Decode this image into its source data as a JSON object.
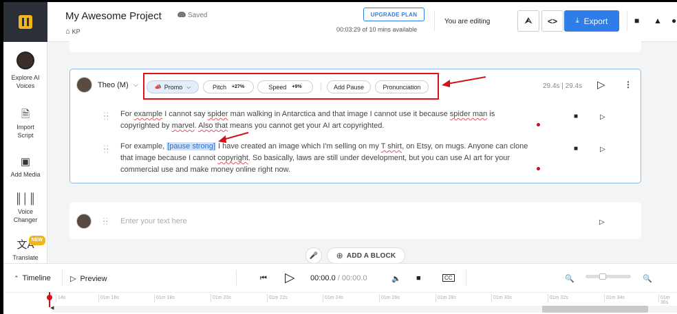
{
  "sidebar": {
    "items": [
      {
        "label_line1": "Explore AI",
        "label_line2": "Voices"
      },
      {
        "label_line1": "Import",
        "label_line2": "Script",
        "icon": "import-icon"
      },
      {
        "label_line1": "Add Media",
        "label_line2": "",
        "icon": "media-icon"
      },
      {
        "label_line1": "Voice",
        "label_line2": "Changer",
        "icon": "waveform-icon"
      },
      {
        "label_line1": "Translate",
        "label_line2": "",
        "icon": "translate-icon",
        "badge": "NEW"
      }
    ]
  },
  "header": {
    "project_title": "My Awesome Project",
    "save_status": "Saved",
    "breadcrumb": "KP",
    "upgrade_label": "UPGRADE PLAN",
    "time_available": "00:03:29 of 10 mins available",
    "editing_status": "You are editing",
    "export_label": "Export"
  },
  "block": {
    "voice_name": "Theo (M)",
    "style_chip": "Promo",
    "pitch_label": "Pitch",
    "pitch_value": "+27%",
    "speed_label": "Speed",
    "speed_value": "+9%",
    "add_pause_label": "Add Pause",
    "pronunciation_label": "Pronunciation",
    "duration_a": "29.4s",
    "duration_sep": "|",
    "duration_b": "29.4s",
    "para1": {
      "t1": "For ",
      "w1": "example",
      "t2": " I cannot say ",
      "w2": "spider",
      "t3": " man walking in Antarctica and that image I cannot use it because ",
      "w3": "spider man",
      "t4": " is copyrighted by ",
      "w4": "marvel",
      "t5": ". ",
      "w5": "Also that",
      "t6": " means you cannot get your AI art copyrighted."
    },
    "para2": {
      "t1": "For example, ",
      "tag": "[pause strong]",
      "t2": " I have created an image which I'm selling on my ",
      "w1": "T shirt",
      "t3": ", on Etsy, on mugs. Anyone can clone that image because I cannot ",
      "w2": "copyright",
      "t4": ". So basically, laws are still under development, but you can use AI art for your commercial use and make money online right now."
    }
  },
  "new_block": {
    "placeholder": "Enter your text here"
  },
  "add_block_label": "ADD A BLOCK",
  "bottom_bar": {
    "timeline_label": "Timeline",
    "preview_label": "Preview",
    "time_current": "00:00.0",
    "time_sep": " / ",
    "time_total": "00:00.0"
  },
  "ruler": {
    "ticks": [
      "14s",
      "01m 16s",
      "01m 18s",
      "01m 20s",
      "01m 22s",
      "01m 24s",
      "01m 26s",
      "01m 28s",
      "01m 30s",
      "01m 32s",
      "01m 34s",
      "01m 36s"
    ]
  },
  "colors": {
    "accent": "#2f7de9",
    "annotation_red": "#e0101a",
    "brand_yellow": "#f2b51b",
    "logo_bg": "#2b2f38"
  }
}
